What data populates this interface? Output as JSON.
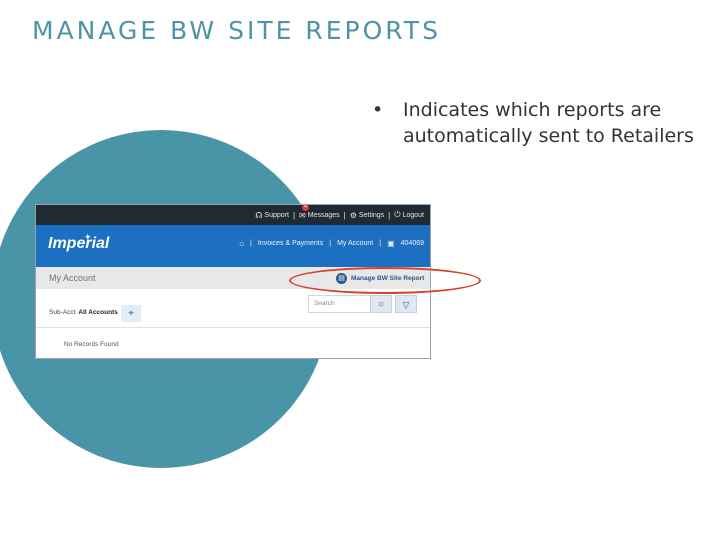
{
  "slide": {
    "title": "MANAGE BW SITE REPORTS",
    "bullet_char": "•",
    "bullet_text": "Indicates which reports are automatically sent to Retailers"
  },
  "colors": {
    "title": "#4f93a6",
    "circle": "#4a94a8",
    "topbar": "#1f2a33",
    "brand_blue": "#1d6fc1",
    "highlight_oval": "#d8412a"
  },
  "screenshot": {
    "topbar": {
      "support_icon": "headset-icon",
      "support": "Support",
      "messages_icon": "envelope-icon",
      "messages": "Messages",
      "messages_badge": "4",
      "settings_icon": "gear-icon",
      "settings": "Settings",
      "logout_icon": "power-icon",
      "logout": "Logout",
      "separator": "|"
    },
    "header": {
      "logo": "Imperial",
      "home_icon": "home-icon",
      "invoices": "Invoices & Payments",
      "my_account": "My Account",
      "account_icon": "store-icon",
      "account_number": "404069"
    },
    "breadcrumb": "My Account",
    "manage_report": {
      "icon": "bw-report-icon",
      "label": "Manage BW Site Report"
    },
    "search": {
      "placeholder": "Search",
      "search_icon": "search-icon",
      "filter_icon": "filter-icon"
    },
    "subaccount": {
      "label": "Sub-Acct",
      "value": "All Accounts",
      "tag_icon": "tag-icon"
    },
    "empty_message": "No Records Found"
  }
}
